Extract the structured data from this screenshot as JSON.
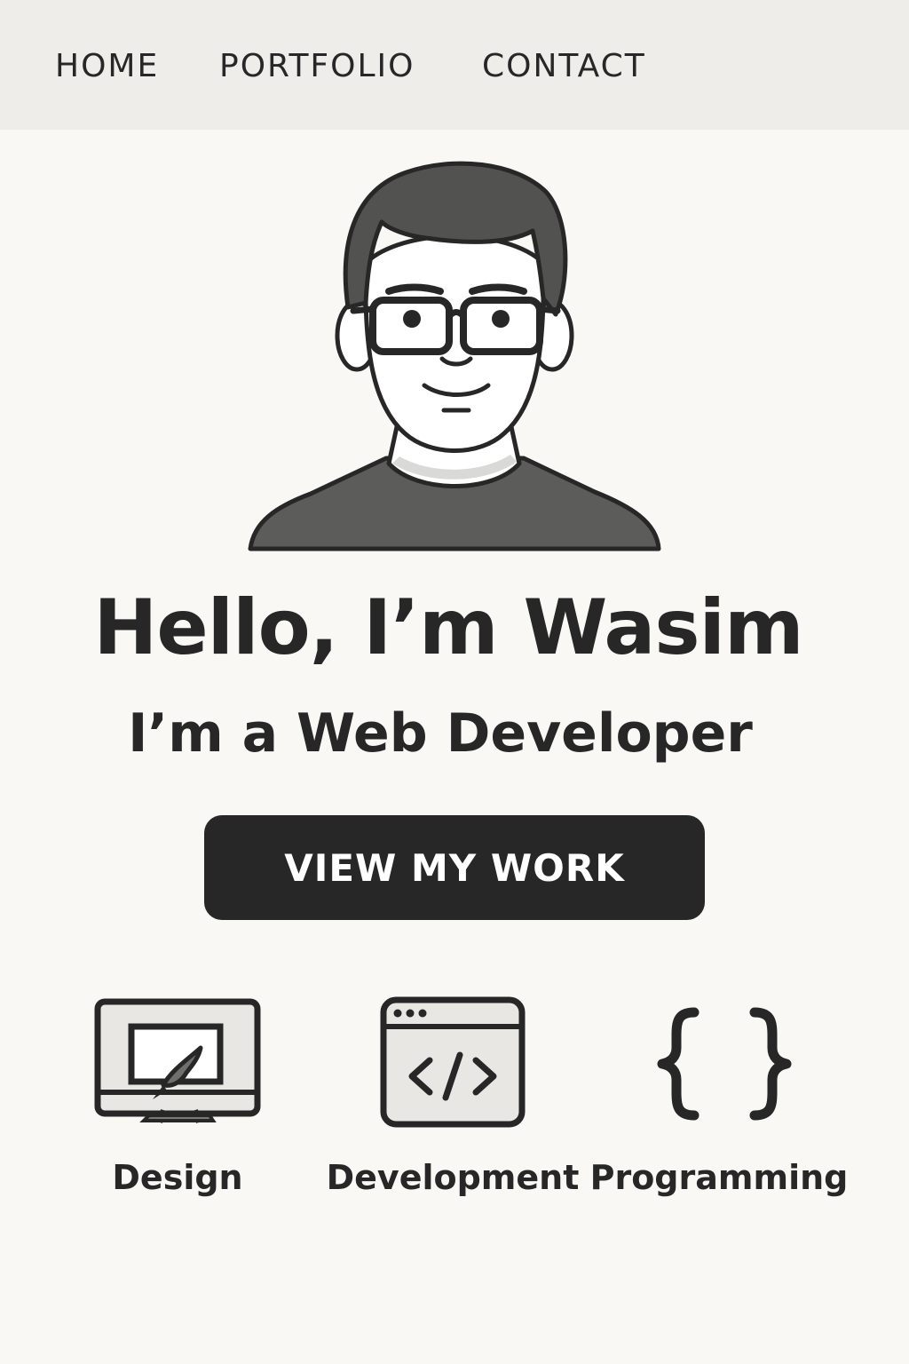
{
  "nav": {
    "items": [
      {
        "label": "HOME"
      },
      {
        "label": "PORTFOLIO"
      },
      {
        "label": "CONTACT"
      }
    ]
  },
  "hero": {
    "avatar_icon": "developer-avatar-icon",
    "title": "Hello, I’m Wasim",
    "subtitle": "I’m a Web Developer",
    "cta_label": "VIEW MY WORK"
  },
  "skills": [
    {
      "label": "Design",
      "icon": "monitor-paintbrush-icon"
    },
    {
      "label": "Development",
      "icon": "browser-code-icon"
    },
    {
      "label": "Programming",
      "icon": "curly-braces-icon"
    }
  ],
  "colors": {
    "background": "#faf8f5",
    "navbar": "#efede9",
    "ink": "#262726",
    "button_text": "#ffffff",
    "shirt": "#5c5c5a",
    "hair": "#525250"
  }
}
